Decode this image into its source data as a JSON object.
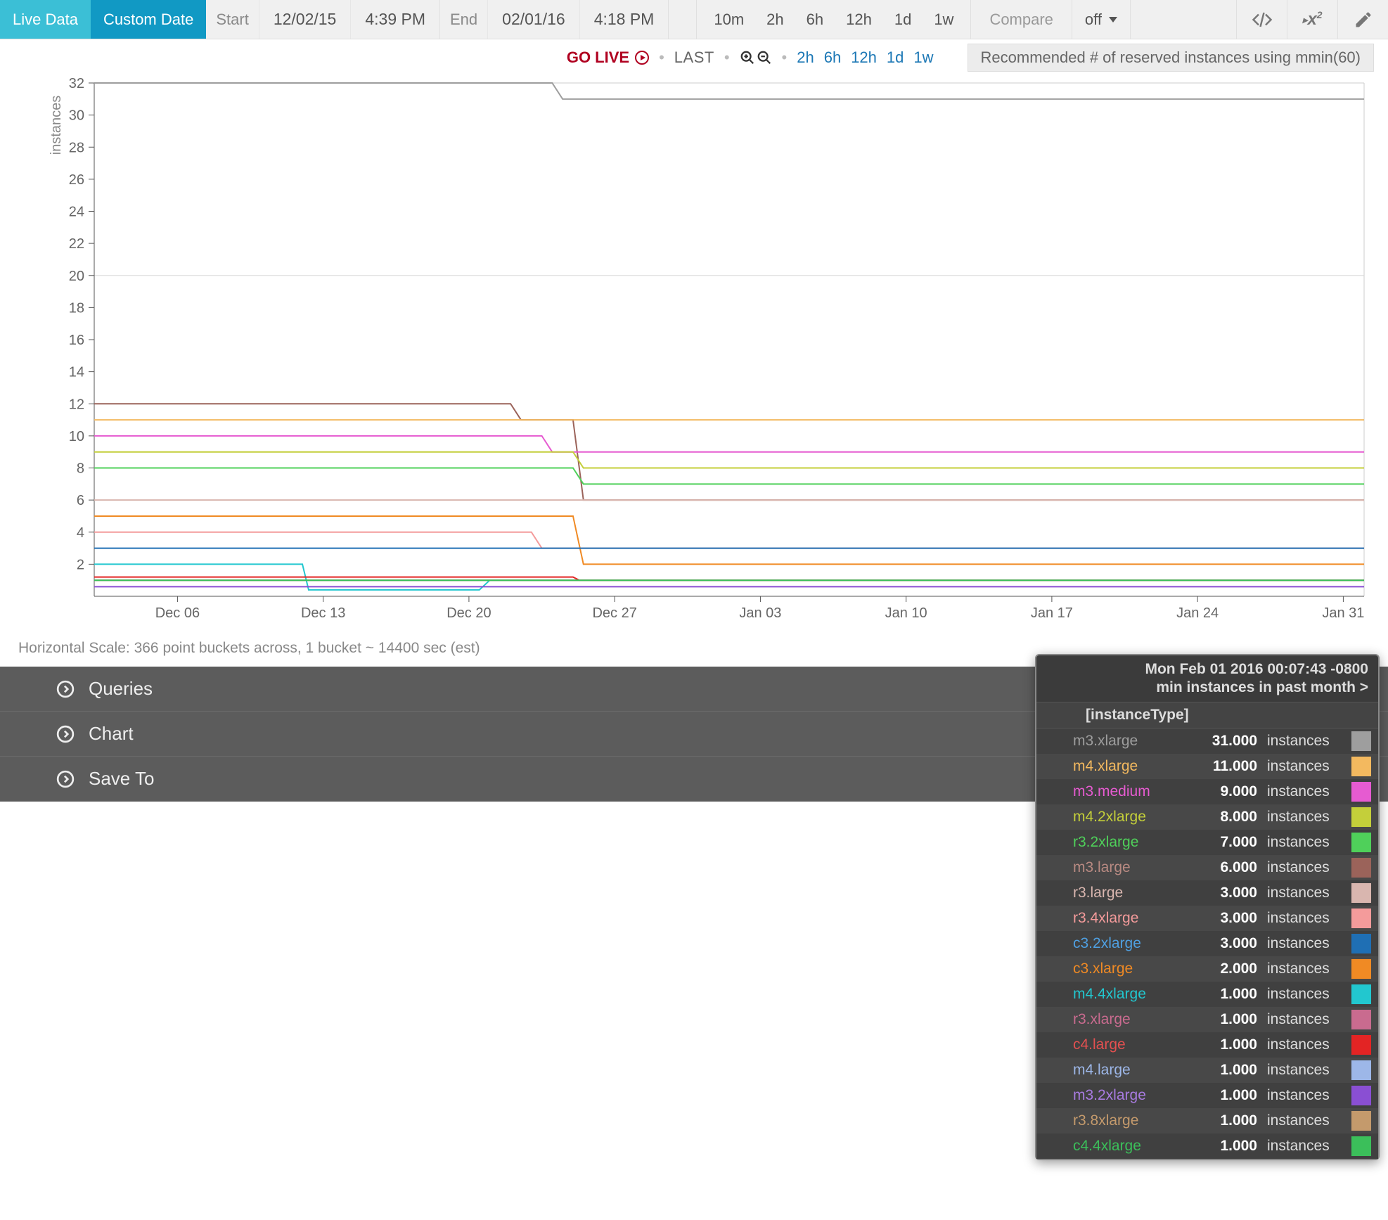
{
  "toolbar": {
    "tab_live": "Live Data",
    "tab_custom": "Custom Date",
    "start_label": "Start",
    "start_date": "12/02/15",
    "start_time": "4:39 PM",
    "end_label": "End",
    "end_date": "02/01/16",
    "end_time": "4:18 PM",
    "ranges": [
      "10m",
      "2h",
      "6h",
      "12h",
      "1d",
      "1w"
    ],
    "compare": "Compare",
    "off": "off"
  },
  "subbar": {
    "golive": "GO LIVE",
    "last": "LAST",
    "quick": [
      "2h",
      "6h",
      "12h",
      "1d",
      "1w"
    ],
    "banner": "Recommended # of reserved instances using mmin(60)"
  },
  "scale_note": "Horizontal Scale: 366 point buckets across, 1 bucket ~ 14400 sec (est)",
  "accordion": {
    "queries": "Queries",
    "chart": "Chart",
    "saveto": "Save To"
  },
  "legend": {
    "timestamp": "Mon Feb 01 2016 00:07:43 -0800",
    "subtitle": "min instances in past month >",
    "group_header": "[instanceType]",
    "unit": "instances",
    "rows": [
      {
        "name": "m3.xlarge",
        "value": "31.000",
        "color": "#9e9e9e",
        "name_color": "#9e9e9e"
      },
      {
        "name": "m4.xlarge",
        "value": "11.000",
        "color": "#f3b95f",
        "name_color": "#f3b95f"
      },
      {
        "name": "m3.medium",
        "value": "9.000",
        "color": "#e65bd1",
        "name_color": "#e65bd1"
      },
      {
        "name": "m4.2xlarge",
        "value": "8.000",
        "color": "#c4cf3a",
        "name_color": "#c4cf3a"
      },
      {
        "name": "r3.2xlarge",
        "value": "7.000",
        "color": "#4fd05a",
        "name_color": "#4fd05a"
      },
      {
        "name": "m3.large",
        "value": "6.000",
        "color": "#9b635a",
        "name_color": "#b88a82"
      },
      {
        "name": "r3.large",
        "value": "3.000",
        "color": "#d9b6af",
        "name_color": "#d9b6af"
      },
      {
        "name": "r3.4xlarge",
        "value": "3.000",
        "color": "#f49b9b",
        "name_color": "#f49b9b"
      },
      {
        "name": "c3.2xlarge",
        "value": "3.000",
        "color": "#1f6fb4",
        "name_color": "#4f9fe0"
      },
      {
        "name": "c3.xlarge",
        "value": "2.000",
        "color": "#f08a24",
        "name_color": "#f08a24"
      },
      {
        "name": "m4.4xlarge",
        "value": "1.000",
        "color": "#22c7cf",
        "name_color": "#22c7cf"
      },
      {
        "name": "r3.xlarge",
        "value": "1.000",
        "color": "#c96b8f",
        "name_color": "#c96b8f"
      },
      {
        "name": "c4.large",
        "value": "1.000",
        "color": "#e32424",
        "name_color": "#e35050"
      },
      {
        "name": "m4.large",
        "value": "1.000",
        "color": "#9db7e8",
        "name_color": "#9db7e8"
      },
      {
        "name": "m3.2xlarge",
        "value": "1.000",
        "color": "#8a4fd3",
        "name_color": "#a87be0"
      },
      {
        "name": "r3.8xlarge",
        "value": "1.000",
        "color": "#c49a6c",
        "name_color": "#c49a6c"
      },
      {
        "name": "c4.4xlarge",
        "value": "1.000",
        "color": "#3bbf5a",
        "name_color": "#3bbf5a"
      }
    ]
  },
  "chart_data": {
    "type": "line",
    "title": "Recommended # of reserved instances using mmin(60)",
    "xlabel": "",
    "ylabel": "instances",
    "ylim": [
      0,
      32
    ],
    "yticks": [
      2,
      4,
      6,
      8,
      10,
      12,
      14,
      16,
      18,
      20,
      22,
      24,
      26,
      28,
      30,
      32
    ],
    "x_categories": [
      "Dec 06",
      "Dec 13",
      "Dec 20",
      "Dec 27",
      "Jan 03",
      "Jan 10",
      "Jan 17",
      "Jan 24",
      "Jan 31"
    ],
    "x_extent_days": 61,
    "series": [
      {
        "name": "m3.xlarge",
        "color": "#9e9e9e",
        "points": [
          [
            0,
            32
          ],
          [
            22,
            32
          ],
          [
            22.5,
            31
          ],
          [
            61,
            31
          ]
        ]
      },
      {
        "name": "m3.large",
        "color": "#9b635a",
        "points": [
          [
            0,
            12
          ],
          [
            20,
            12
          ],
          [
            20.5,
            11
          ],
          [
            23,
            11
          ],
          [
            23.5,
            6
          ],
          [
            61,
            6
          ]
        ]
      },
      {
        "name": "m4.xlarge",
        "color": "#f3b95f",
        "points": [
          [
            0,
            11
          ],
          [
            61,
            11
          ]
        ]
      },
      {
        "name": "m3.medium",
        "color": "#e65bd1",
        "points": [
          [
            0,
            10
          ],
          [
            21.5,
            10
          ],
          [
            22,
            9
          ],
          [
            61,
            9
          ]
        ]
      },
      {
        "name": "m4.2xlarge",
        "color": "#c4cf3a",
        "points": [
          [
            0,
            9
          ],
          [
            23,
            9
          ],
          [
            23.5,
            8
          ],
          [
            61,
            8
          ]
        ]
      },
      {
        "name": "r3.2xlarge",
        "color": "#4fd05a",
        "points": [
          [
            0,
            8
          ],
          [
            23,
            8
          ],
          [
            23.5,
            7
          ],
          [
            61,
            7
          ]
        ]
      },
      {
        "name": "r3.large",
        "color": "#d9b6af",
        "points": [
          [
            0,
            6
          ],
          [
            61,
            6
          ]
        ]
      },
      {
        "name": "c3.xlarge",
        "color": "#f08a24",
        "points": [
          [
            0,
            5
          ],
          [
            23,
            5
          ],
          [
            23.5,
            2
          ],
          [
            61,
            2
          ]
        ]
      },
      {
        "name": "r3.4xlarge",
        "color": "#f49b9b",
        "points": [
          [
            0,
            4
          ],
          [
            21,
            4
          ],
          [
            21.5,
            3
          ],
          [
            61,
            3
          ]
        ]
      },
      {
        "name": "c3.2xlarge",
        "color": "#1f6fb4",
        "points": [
          [
            0,
            3
          ],
          [
            61,
            3
          ]
        ]
      },
      {
        "name": "m4.4xlarge",
        "color": "#22c7cf",
        "points": [
          [
            0,
            2
          ],
          [
            10,
            2
          ],
          [
            10.3,
            0.4
          ],
          [
            18.5,
            0.4
          ],
          [
            19,
            1
          ],
          [
            61,
            1
          ]
        ]
      },
      {
        "name": "m4.large",
        "color": "#9db7e8",
        "points": [
          [
            0,
            1
          ],
          [
            61,
            1
          ]
        ]
      },
      {
        "name": "m3.2xlarge",
        "color": "#8a4fd3",
        "points": [
          [
            0,
            0.6
          ],
          [
            61,
            0.6
          ]
        ]
      },
      {
        "name": "c4.large",
        "color": "#e32424",
        "points": [
          [
            0,
            1.2
          ],
          [
            23,
            1.2
          ],
          [
            23.3,
            1
          ],
          [
            61,
            1
          ]
        ]
      },
      {
        "name": "r3.xlarge",
        "color": "#c96b8f",
        "points": [
          [
            0,
            1.0
          ],
          [
            61,
            1.0
          ]
        ]
      },
      {
        "name": "r3.8xlarge",
        "color": "#c49a6c",
        "points": [
          [
            0,
            1.0
          ],
          [
            61,
            1.0
          ]
        ]
      },
      {
        "name": "c4.4xlarge",
        "color": "#3bbf5a",
        "points": [
          [
            0,
            1.0
          ],
          [
            61,
            1.0
          ]
        ]
      }
    ]
  }
}
